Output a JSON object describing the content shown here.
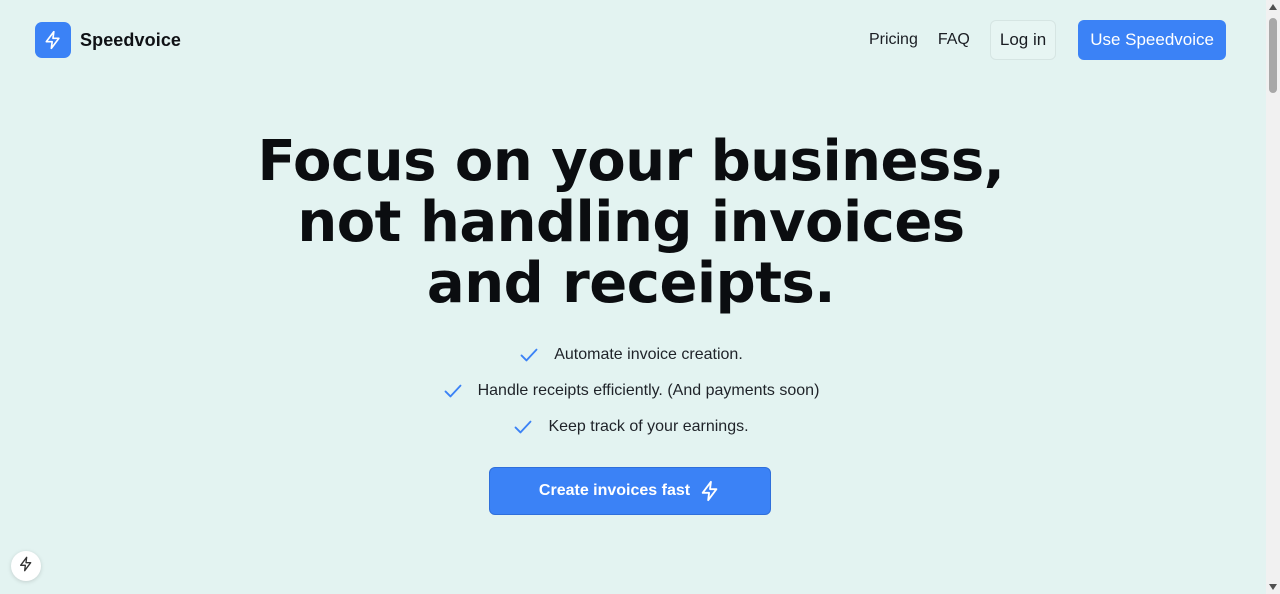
{
  "brand": {
    "name": "Speedvoice",
    "accent_color": "#3b82f6",
    "icon": "bolt-icon"
  },
  "nav": {
    "pricing": "Pricing",
    "faq": "FAQ",
    "login": "Log in",
    "cta": "Use Speedvoice"
  },
  "hero": {
    "title_lines": [
      "Focus on your business,",
      "not handling invoices",
      "and receipts."
    ],
    "features": [
      "Automate invoice creation.",
      "Handle receipts efficiently. (And payments soon)",
      "Keep track of your earnings."
    ],
    "cta": "Create invoices fast"
  },
  "colors": {
    "background": "#e3f3f1",
    "check": "#3b82f6"
  }
}
